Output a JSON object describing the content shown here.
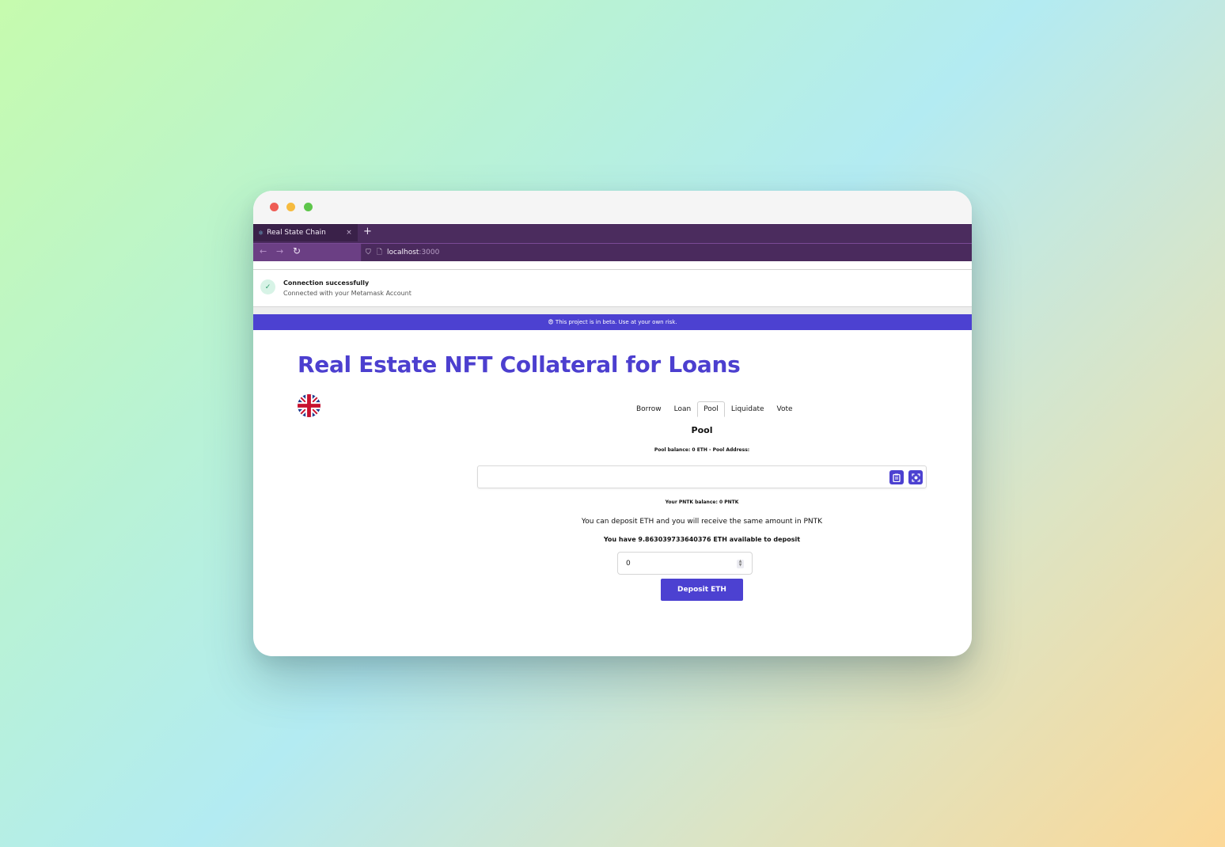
{
  "browser": {
    "tab_title": "Real State Chain",
    "tab_close": "×",
    "new_tab": "+",
    "url_host": "localhost",
    "url_port": ":3000"
  },
  "toast": {
    "title": "Connection successfully",
    "message": "Connected with your Metamask Account",
    "status_icon": "check-icon"
  },
  "beta_banner": "😨 This project is in beta. Use at your own risk.",
  "page": {
    "title": "Real Estate NFT Collateral for Loans",
    "language_icon": "uk-flag-icon"
  },
  "nav_tabs": [
    {
      "label": "Borrow"
    },
    {
      "label": "Loan"
    },
    {
      "label": "Pool"
    },
    {
      "label": "Liquidate"
    },
    {
      "label": "Vote"
    }
  ],
  "pool": {
    "heading": "Pool",
    "balance_line": "Pool balance: 0 ETH - Pool Address:",
    "address_value": "",
    "pntk_balance": "Your PNTK balance: 0 PNTK",
    "description": "You can deposit ETH and you will receive the same amount in PNTK",
    "available": "You have 9.863039733640376 ETH available to deposit",
    "amount_value": "0",
    "deposit_label": "Deposit ETH"
  },
  "colors": {
    "accent": "#4c41d1",
    "browser_chrome": "#4b2c5e"
  }
}
